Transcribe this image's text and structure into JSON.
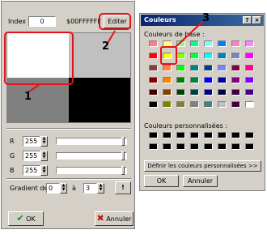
{
  "editor": {
    "index_label": "Index",
    "index_value": "0",
    "hex_value": "$00FFFFFF",
    "edit_button": "Editer",
    "channels": [
      {
        "label": "R",
        "value": "255"
      },
      {
        "label": "G",
        "value": "255"
      },
      {
        "label": "B",
        "value": "255"
      }
    ],
    "gradient_label": "Gradient de",
    "gradient_from": "0",
    "gradient_to_label": "à",
    "gradient_to": "3",
    "gradient_button": "!",
    "ok_button": "OK",
    "cancel_button": "Annuler",
    "preview_colors": [
      "#ffffff",
      "#c0c0c0",
      "#808080",
      "#000000"
    ]
  },
  "colors_dialog": {
    "title": "Couleurs",
    "help_button": "?",
    "close_button": "×",
    "basic_label": "Couleurs de base :",
    "basic_colors": [
      "#ff8080",
      "#ffff80",
      "#80ff80",
      "#00ff80",
      "#80ffff",
      "#0080ff",
      "#ff80c0",
      "#ff80ff",
      "#ff0000",
      "#ffff00",
      "#80ff00",
      "#00ff40",
      "#00ffff",
      "#0080c0",
      "#8080c0",
      "#ff00ff",
      "#804040",
      "#ff8040",
      "#00ff00",
      "#008080",
      "#004080",
      "#8080ff",
      "#800040",
      "#ff0080",
      "#800000",
      "#ff8000",
      "#008000",
      "#008040",
      "#0000ff",
      "#0000a0",
      "#800080",
      "#8000ff",
      "#400000",
      "#804000",
      "#004000",
      "#004040",
      "#000080",
      "#000040",
      "#400040",
      "#400080",
      "#000000",
      "#808000",
      "#808040",
      "#808080",
      "#408080",
      "#c0c0c0",
      "#400040",
      "#ffffff"
    ],
    "custom_label": "Couleurs personnalisées :",
    "define_button": "Définir les couleurs personnalisées >>",
    "ok_button": "OK",
    "cancel_button": "Annuler"
  },
  "annotations": {
    "callout_1": "1",
    "callout_2": "2",
    "callout_3": "3",
    "highlight_color": "#e8101a"
  }
}
